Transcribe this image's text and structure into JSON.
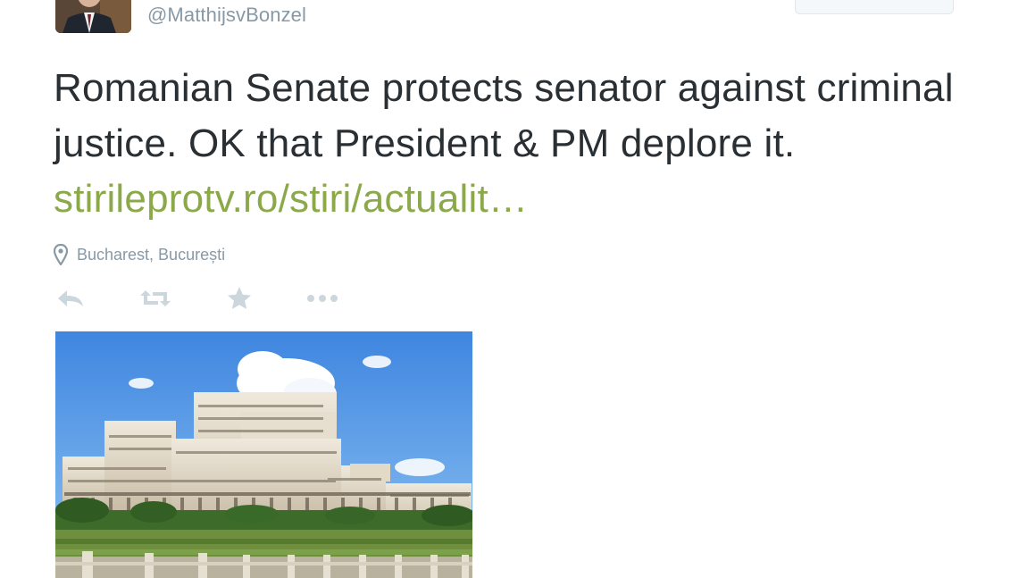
{
  "tweet": {
    "handle": "@MatthijsvBonzel",
    "text": "Romanian Senate protects senator against criminal justice. OK that President & PM deplore it. ",
    "link_text": "stirileprotv.ro/stiri/actualit…",
    "location": "Bucharest, București"
  },
  "actions": {
    "reply_icon": "reply-icon",
    "retweet_icon": "retweet-icon",
    "favorite_icon": "star-icon",
    "more_icon": "more-icon"
  },
  "colors": {
    "text": "#292f33",
    "link": "#8ba94a",
    "muted": "#8899a6",
    "icon": "#ccd6dd"
  }
}
